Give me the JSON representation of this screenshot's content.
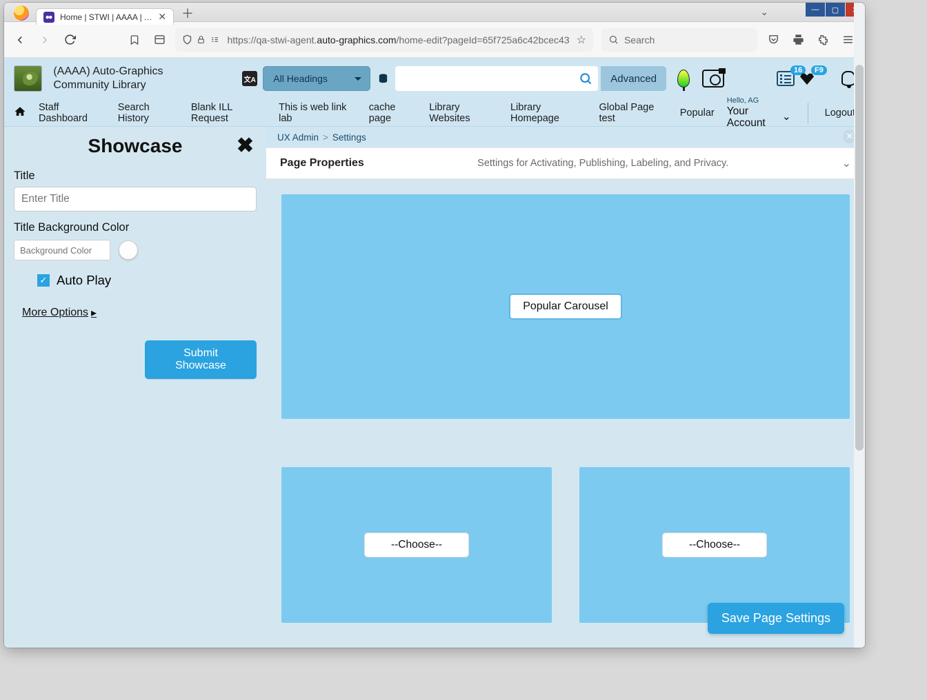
{
  "browser": {
    "tab_title": "Home | STWI | AAAA | Auto-Gr",
    "url_prefix": "https://qa-stwi-agent.",
    "url_domain": "auto-graphics.com",
    "url_path": "/home-edit?pageId=65f725a6c42bcec43",
    "search_placeholder": "Search"
  },
  "site": {
    "title": "(AAAA) Auto-Graphics Community Library",
    "headings": "All Headings",
    "advanced": "Advanced",
    "badge_list": "16",
    "badge_heart": "F9",
    "hello": "Hello, AG",
    "account": "Your Account",
    "logout": "Logout"
  },
  "nav": {
    "items": [
      "Staff Dashboard",
      "Search History",
      "Blank ILL Request",
      "This is web link lab",
      "cache page",
      "Library Websites",
      "Library Homepage",
      "Global Page test",
      "Popular"
    ]
  },
  "sidebar": {
    "heading": "Showcase",
    "title_label": "Title",
    "title_placeholder": "Enter Title",
    "bg_label": "Title Background Color",
    "bg_placeholder": "Background Color",
    "autoplay": "Auto Play",
    "more": "More Options",
    "submit": "Submit Showcase"
  },
  "main": {
    "crumb1": "UX Admin",
    "crumb2": "Settings",
    "prop_title": "Page Properties",
    "prop_desc": "Settings for Activating, Publishing, Labeling, and Privacy.",
    "slot_big": "Popular Carousel",
    "slot_choose": "--Choose--",
    "save": "Save Page Settings"
  }
}
